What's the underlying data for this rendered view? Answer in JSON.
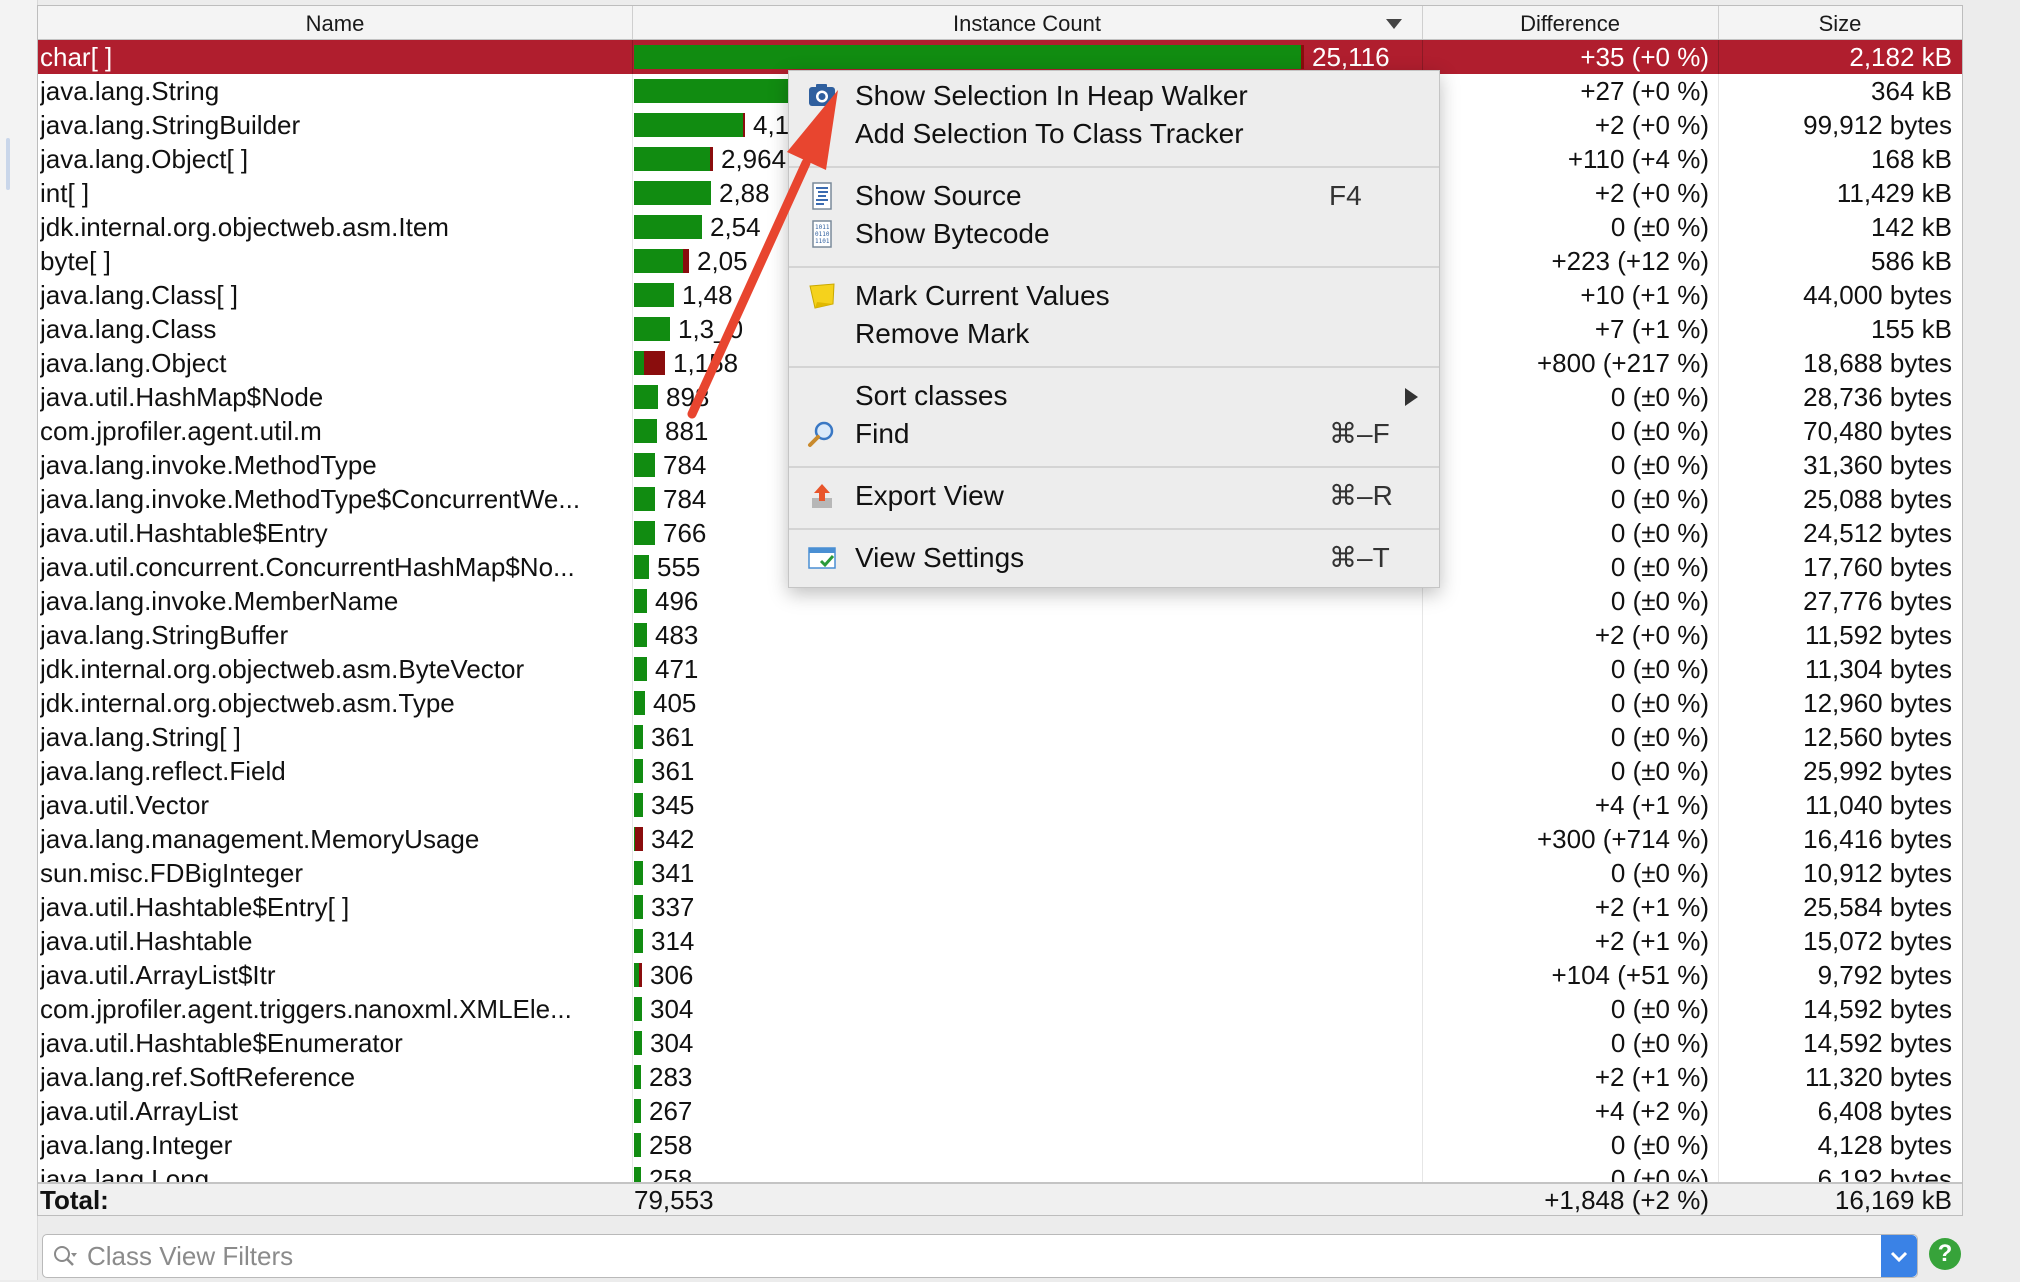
{
  "columns": {
    "name": "Name",
    "count": "Instance Count",
    "difference": "Difference",
    "size": "Size"
  },
  "rows": [
    {
      "name": "char[ ]",
      "count": "25,116",
      "diff": "+35 (+0 %)",
      "size": "2,182 kB",
      "bar_fraction": 1.0,
      "red_fraction": 0.005,
      "count_visible": true
    },
    {
      "name": "java.lang.String",
      "count": "",
      "diff": "+27 (+0 %)",
      "size": "364 kB",
      "bar_fraction": 0.245,
      "red_fraction": 0.0,
      "count_visible": false
    },
    {
      "name": "java.lang.StringBuilder",
      "count": "4,1",
      "diff": "+2 (+0 %)",
      "size": "99,912 bytes",
      "bar_fraction": 0.165,
      "red_fraction": 0.003,
      "count_visible": true
    },
    {
      "name": "java.lang.Object[ ]",
      "count": "2,964",
      "diff": "+110 (+4 %)",
      "size": "168 kB",
      "bar_fraction": 0.118,
      "red_fraction": 0.005,
      "count_visible": true
    },
    {
      "name": "int[ ]",
      "count": "2,88",
      "diff": "+2 (+0 %)",
      "size": "11,429 kB",
      "bar_fraction": 0.115,
      "red_fraction": 0.0,
      "count_visible": true
    },
    {
      "name": "jdk.internal.org.objectweb.asm.Item",
      "count": "2,54",
      "diff": "0 (±0 %)",
      "size": "142 kB",
      "bar_fraction": 0.101,
      "red_fraction": 0.0,
      "count_visible": true
    },
    {
      "name": "byte[ ]",
      "count": "2,05",
      "diff": "+223 (+12 %)",
      "size": "586 kB",
      "bar_fraction": 0.082,
      "red_fraction": 0.009,
      "count_visible": true
    },
    {
      "name": "java.lang.Class[ ]",
      "count": "1,48",
      "diff": "+10 (+1 %)",
      "size": "44,000 bytes",
      "bar_fraction": 0.059,
      "red_fraction": 0.0,
      "count_visible": true
    },
    {
      "name": "java.lang.Class",
      "count": "1,3_0",
      "diff": "+7 (+1 %)",
      "size": "155 kB",
      "bar_fraction": 0.054,
      "red_fraction": 0.0,
      "count_visible": true
    },
    {
      "name": "java.lang.Object",
      "count": "1,158",
      "diff": "+800 (+217 %)",
      "size": "18,688 bytes",
      "bar_fraction": 0.046,
      "red_fraction": 0.032,
      "count_visible": true
    },
    {
      "name": "java.util.HashMap$Node",
      "count": "898",
      "diff": "0 (±0 %)",
      "size": "28,736 bytes",
      "bar_fraction": 0.036,
      "red_fraction": 0.0,
      "count_visible": true
    },
    {
      "name": "com.jprofiler.agent.util.m",
      "count": "881",
      "diff": "0 (±0 %)",
      "size": "70,480 bytes",
      "bar_fraction": 0.035,
      "red_fraction": 0.0,
      "count_visible": true
    },
    {
      "name": "java.lang.invoke.MethodType",
      "count": "784",
      "diff": "0 (±0 %)",
      "size": "31,360 bytes",
      "bar_fraction": 0.031,
      "red_fraction": 0.0,
      "count_visible": true
    },
    {
      "name": "java.lang.invoke.MethodType$ConcurrentWe...",
      "count": "784",
      "diff": "0 (±0 %)",
      "size": "25,088 bytes",
      "bar_fraction": 0.031,
      "red_fraction": 0.0,
      "count_visible": true
    },
    {
      "name": "java.util.Hashtable$Entry",
      "count": "766",
      "diff": "0 (±0 %)",
      "size": "24,512 bytes",
      "bar_fraction": 0.031,
      "red_fraction": 0.0,
      "count_visible": true
    },
    {
      "name": "java.util.concurrent.ConcurrentHashMap$No...",
      "count": "555",
      "diff": "0 (±0 %)",
      "size": "17,760 bytes",
      "bar_fraction": 0.022,
      "red_fraction": 0.0,
      "count_visible": true
    },
    {
      "name": "java.lang.invoke.MemberName",
      "count": "496",
      "diff": "0 (±0 %)",
      "size": "27,776 bytes",
      "bar_fraction": 0.02,
      "red_fraction": 0.0,
      "count_visible": true
    },
    {
      "name": "java.lang.StringBuffer",
      "count": "483",
      "diff": "+2 (+0 %)",
      "size": "11,592 bytes",
      "bar_fraction": 0.019,
      "red_fraction": 0.0,
      "count_visible": true
    },
    {
      "name": "jdk.internal.org.objectweb.asm.ByteVector",
      "count": "471",
      "diff": "0 (±0 %)",
      "size": "11,304 bytes",
      "bar_fraction": 0.019,
      "red_fraction": 0.0,
      "count_visible": true
    },
    {
      "name": "jdk.internal.org.objectweb.asm.Type",
      "count": "405",
      "diff": "0 (±0 %)",
      "size": "12,960 bytes",
      "bar_fraction": 0.016,
      "red_fraction": 0.0,
      "count_visible": true
    },
    {
      "name": "java.lang.String[ ]",
      "count": "361",
      "diff": "0 (±0 %)",
      "size": "12,560 bytes",
      "bar_fraction": 0.014,
      "red_fraction": 0.0,
      "count_visible": true
    },
    {
      "name": "java.lang.reflect.Field",
      "count": "361",
      "diff": "0 (±0 %)",
      "size": "25,992 bytes",
      "bar_fraction": 0.014,
      "red_fraction": 0.0,
      "count_visible": true
    },
    {
      "name": "java.util.Vector",
      "count": "345",
      "diff": "+4 (+1 %)",
      "size": "11,040 bytes",
      "bar_fraction": 0.014,
      "red_fraction": 0.0,
      "count_visible": true
    },
    {
      "name": "java.lang.management.MemoryUsage",
      "count": "342",
      "diff": "+300 (+714 %)",
      "size": "16,416 bytes",
      "bar_fraction": 0.014,
      "red_fraction": 0.012,
      "count_visible": true
    },
    {
      "name": "sun.misc.FDBigInteger",
      "count": "341",
      "diff": "0 (±0 %)",
      "size": "10,912 bytes",
      "bar_fraction": 0.014,
      "red_fraction": 0.0,
      "count_visible": true
    },
    {
      "name": "java.util.Hashtable$Entry[ ]",
      "count": "337",
      "diff": "+2 (+1 %)",
      "size": "25,584 bytes",
      "bar_fraction": 0.013,
      "red_fraction": 0.0,
      "count_visible": true
    },
    {
      "name": "java.util.Hashtable",
      "count": "314",
      "diff": "+2 (+1 %)",
      "size": "15,072 bytes",
      "bar_fraction": 0.013,
      "red_fraction": 0.0,
      "count_visible": true
    },
    {
      "name": "java.util.ArrayList$Itr",
      "count": "306",
      "diff": "+104 (+51 %)",
      "size": "9,792 bytes",
      "bar_fraction": 0.012,
      "red_fraction": 0.004,
      "count_visible": true
    },
    {
      "name": "com.jprofiler.agent.triggers.nanoxml.XMLEle...",
      "count": "304",
      "diff": "0 (±0 %)",
      "size": "14,592 bytes",
      "bar_fraction": 0.012,
      "red_fraction": 0.0,
      "count_visible": true
    },
    {
      "name": "java.util.Hashtable$Enumerator",
      "count": "304",
      "diff": "0 (±0 %)",
      "size": "14,592 bytes",
      "bar_fraction": 0.012,
      "red_fraction": 0.0,
      "count_visible": true
    },
    {
      "name": "java.lang.ref.SoftReference",
      "count": "283",
      "diff": "+2 (+1 %)",
      "size": "11,320 bytes",
      "bar_fraction": 0.011,
      "red_fraction": 0.0,
      "count_visible": true
    },
    {
      "name": "java.util.ArrayList",
      "count": "267",
      "diff": "+4 (+2 %)",
      "size": "6,408 bytes",
      "bar_fraction": 0.011,
      "red_fraction": 0.0,
      "count_visible": true
    },
    {
      "name": "java.lang.Integer",
      "count": "258",
      "diff": "0 (±0 %)",
      "size": "4,128 bytes",
      "bar_fraction": 0.01,
      "red_fraction": 0.0,
      "count_visible": true
    },
    {
      "name": "java.lang.Long",
      "count": "258",
      "diff": "0 (±0 %)",
      "size": "6,192 bytes",
      "bar_fraction": 0.01,
      "red_fraction": 0.0,
      "count_visible": true
    }
  ],
  "total": {
    "label": "Total:",
    "count": "79,553",
    "diff": "+1,848 (+2 %)",
    "size": "16,169 kB"
  },
  "context_menu": {
    "show_in_heap_walker": "Show Selection In Heap Walker",
    "add_to_class_tracker": "Add Selection To Class Tracker",
    "show_source": "Show Source",
    "show_source_shortcut": "F4",
    "show_bytecode": "Show Bytecode",
    "mark_current_values": "Mark Current Values",
    "remove_mark": "Remove Mark",
    "sort_classes": "Sort classes",
    "find": "Find",
    "find_shortcut": "⌘–F",
    "export_view": "Export View",
    "export_shortcut": "⌘–R",
    "view_settings": "View Settings",
    "view_settings_shortcut": "⌘–T"
  },
  "filter": {
    "placeholder": "Class View Filters",
    "value": ""
  },
  "help": {
    "label": "?"
  },
  "colors": {
    "selection": "#b01e2e",
    "bar_green": "#118c11",
    "bar_red": "#8a0d0d",
    "annotation_arrow": "#e8452f",
    "dropdown_blue": "#3a82e6",
    "help_green": "#37a33a"
  }
}
